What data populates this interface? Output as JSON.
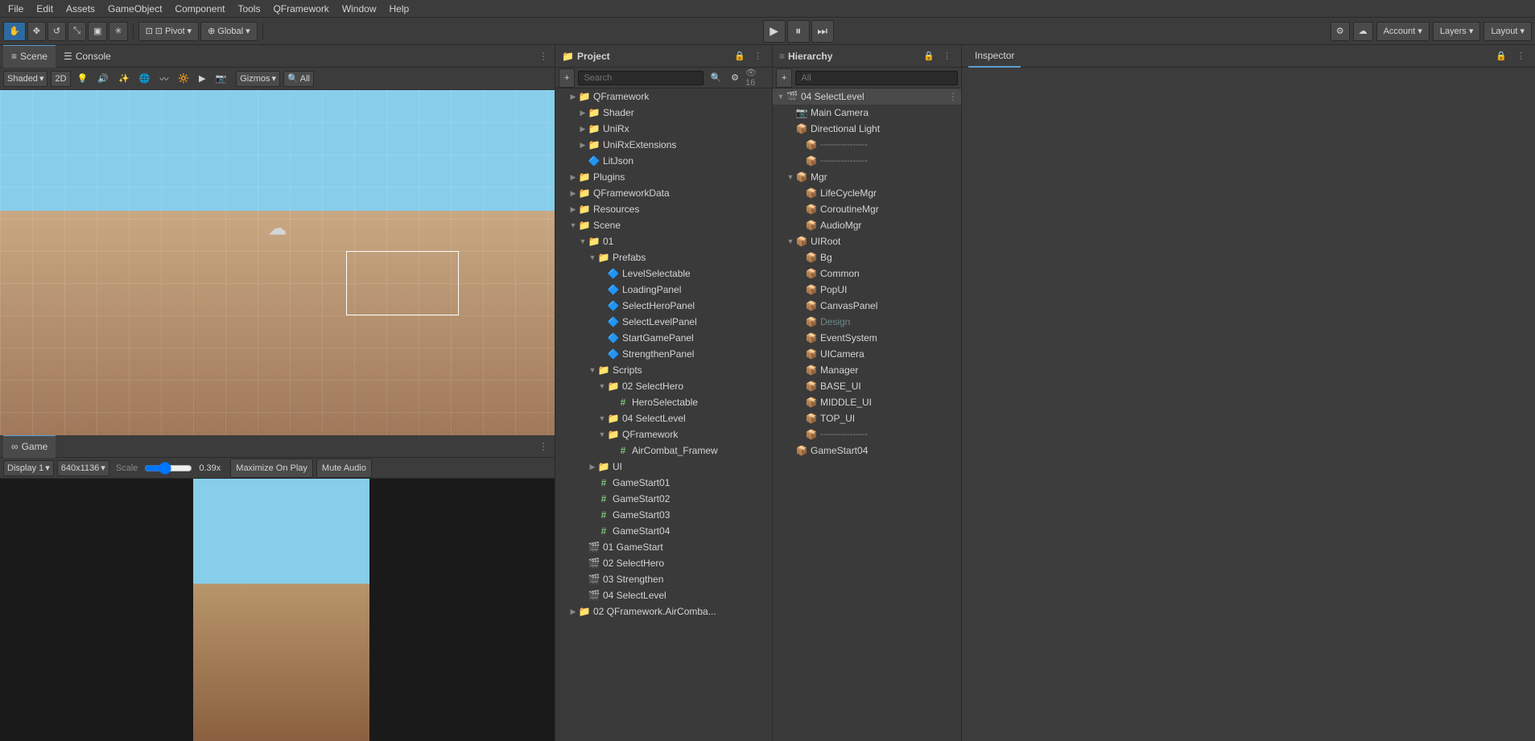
{
  "menubar": {
    "items": [
      "File",
      "Edit",
      "Assets",
      "GameObject",
      "Component",
      "Tools",
      "QFramework",
      "Window",
      "Help"
    ]
  },
  "toolbar": {
    "tools": [
      {
        "name": "hand",
        "icon": "✋",
        "label": "Hand Tool"
      },
      {
        "name": "move",
        "icon": "✥",
        "label": "Move Tool"
      },
      {
        "name": "rotate",
        "icon": "↺",
        "label": "Rotate Tool"
      },
      {
        "name": "scale",
        "icon": "⤡",
        "label": "Scale Tool"
      },
      {
        "name": "rect",
        "icon": "▣",
        "label": "Rect Tool"
      },
      {
        "name": "transform",
        "icon": "✳",
        "label": "Transform Tool"
      }
    ],
    "pivot_label": "⊡ Pivot",
    "global_label": "⊕ Global",
    "play_label": "▶",
    "pause_label": "⏸",
    "step_label": "⏭",
    "account_label": "Account",
    "layers_label": "Layers",
    "layout_label": "Layout",
    "cloud_icon": "☁",
    "settings_icon": "⚙"
  },
  "scene_panel": {
    "tabs": [
      {
        "name": "scene",
        "icon": "≡",
        "label": "Scene"
      },
      {
        "name": "console",
        "icon": "☰",
        "label": "Console"
      }
    ],
    "toolbar": {
      "shaded_label": "Shaded",
      "2d_label": "2D",
      "gizmos_label": "Gizmos",
      "all_label": "All"
    }
  },
  "game_panel": {
    "tab_label": "Game",
    "tab_icon": "∞",
    "display_label": "Display 1",
    "resolution_label": "640x1136",
    "scale_label": "Scale",
    "scale_value": "0.39x",
    "maximize_label": "Maximize On Play",
    "mute_label": "Mute Audio",
    "menu_icon": "⋮"
  },
  "project_panel": {
    "title": "Project",
    "lock_icon": "🔒",
    "menu_icon": "⋮",
    "add_icon": "+",
    "search_placeholder": "Search",
    "count_label": "16",
    "tree": [
      {
        "id": "qframework",
        "indent": 1,
        "arrow": "▶",
        "icon": "📁",
        "label": "QFramework",
        "type": "folder"
      },
      {
        "id": "shader",
        "indent": 2,
        "arrow": "▶",
        "icon": "📁",
        "label": "Shader",
        "type": "folder"
      },
      {
        "id": "unirx",
        "indent": 2,
        "arrow": "▶",
        "icon": "📁",
        "label": "UniRx",
        "type": "folder"
      },
      {
        "id": "unirxextensions",
        "indent": 2,
        "arrow": "▶",
        "icon": "📁",
        "label": "UniRxExtensions",
        "type": "folder"
      },
      {
        "id": "litjson",
        "indent": 2,
        "arrow": " ",
        "icon": "📄",
        "label": "LitJson",
        "type": "file"
      },
      {
        "id": "plugins",
        "indent": 1,
        "arrow": "▶",
        "icon": "📁",
        "label": "Plugins",
        "type": "folder"
      },
      {
        "id": "qframeworkdata",
        "indent": 1,
        "arrow": "▶",
        "icon": "📁",
        "label": "QFrameworkData",
        "type": "folder"
      },
      {
        "id": "resources",
        "indent": 1,
        "arrow": "▶",
        "icon": "📁",
        "label": "Resources",
        "type": "folder"
      },
      {
        "id": "scene",
        "indent": 1,
        "arrow": "▼",
        "icon": "📁",
        "label": "Scene",
        "type": "folder"
      },
      {
        "id": "01",
        "indent": 2,
        "arrow": "▼",
        "icon": "📁",
        "label": "01",
        "type": "folder"
      },
      {
        "id": "prefabs",
        "indent": 3,
        "arrow": "▼",
        "icon": "📁",
        "label": "Prefabs",
        "type": "folder"
      },
      {
        "id": "levelselectable",
        "indent": 4,
        "arrow": " ",
        "icon": "🔷",
        "label": "LevelSelectable",
        "type": "prefab"
      },
      {
        "id": "loadingpanel",
        "indent": 4,
        "arrow": " ",
        "icon": "🔷",
        "label": "LoadingPanel",
        "type": "prefab"
      },
      {
        "id": "selectheropanel",
        "indent": 4,
        "arrow": " ",
        "icon": "🔷",
        "label": "SelectHeroPanel",
        "type": "prefab"
      },
      {
        "id": "selectlevelpanel",
        "indent": 4,
        "arrow": " ",
        "icon": "🔷",
        "label": "SelectLevelPanel",
        "type": "prefab"
      },
      {
        "id": "startgamepanel",
        "indent": 4,
        "arrow": " ",
        "icon": "🔷",
        "label": "StartGamePanel",
        "type": "prefab"
      },
      {
        "id": "strengthenpanel",
        "indent": 4,
        "arrow": " ",
        "icon": "🔷",
        "label": "StrengthenPanel",
        "type": "prefab"
      },
      {
        "id": "scripts",
        "indent": 3,
        "arrow": "▼",
        "icon": "📁",
        "label": "Scripts",
        "type": "folder"
      },
      {
        "id": "02selecthero",
        "indent": 4,
        "arrow": "▼",
        "icon": "📁",
        "label": "02 SelectHero",
        "type": "folder"
      },
      {
        "id": "heroselectable",
        "indent": 5,
        "arrow": " ",
        "icon": "#",
        "label": "HeroSelectable",
        "type": "script"
      },
      {
        "id": "04selectlevel",
        "indent": 4,
        "arrow": "▼",
        "icon": "📁",
        "label": "04 SelectLevel",
        "type": "folder"
      },
      {
        "id": "qframework2",
        "indent": 4,
        "arrow": "▼",
        "icon": "📁",
        "label": "QFramework",
        "type": "folder"
      },
      {
        "id": "aircombatframew",
        "indent": 5,
        "arrow": " ",
        "icon": "#",
        "label": "AirCombat_Framew",
        "type": "script"
      },
      {
        "id": "ui",
        "indent": 3,
        "arrow": "▶",
        "icon": "📁",
        "label": "UI",
        "type": "folder"
      },
      {
        "id": "gamestart01",
        "indent": 3,
        "arrow": " ",
        "icon": "#",
        "label": "GameStart01",
        "type": "script"
      },
      {
        "id": "gamestart02",
        "indent": 3,
        "arrow": " ",
        "icon": "#",
        "label": "GameStart02",
        "type": "script"
      },
      {
        "id": "gamestart03",
        "indent": 3,
        "arrow": " ",
        "icon": "#",
        "label": "GameStart03",
        "type": "script"
      },
      {
        "id": "gamestart04",
        "indent": 3,
        "arrow": " ",
        "icon": "#",
        "label": "GameStart04",
        "type": "script"
      },
      {
        "id": "scene01gamestart",
        "indent": 2,
        "arrow": " ",
        "icon": "🎬",
        "label": "01 GameStart",
        "type": "scene"
      },
      {
        "id": "scene02selecthero",
        "indent": 2,
        "arrow": " ",
        "icon": "🎬",
        "label": "02 SelectHero",
        "type": "scene"
      },
      {
        "id": "scene03strengthen",
        "indent": 2,
        "arrow": " ",
        "icon": "🎬",
        "label": "03 Strengthen",
        "type": "scene"
      },
      {
        "id": "scene04selectlevel",
        "indent": 2,
        "arrow": " ",
        "icon": "🎬",
        "label": "04 SelectLevel",
        "type": "scene"
      },
      {
        "id": "02qframeworkaircomba",
        "indent": 1,
        "arrow": "▶",
        "icon": "📁",
        "label": "02 QFramework.AirComba...",
        "type": "folder"
      }
    ]
  },
  "hierarchy_panel": {
    "title": "Hierarchy",
    "lock_icon": "🔒",
    "menu_icon": "⋮",
    "add_icon": "+",
    "search_placeholder": "All",
    "selected_scene": "04 SelectLevel",
    "tree": [
      {
        "id": "04selectlevel",
        "indent": 0,
        "arrow": "▼",
        "icon": "🎬",
        "label": "04 SelectLevel",
        "type": "scene",
        "selected": false,
        "menu": true
      },
      {
        "id": "maincamera",
        "indent": 1,
        "arrow": " ",
        "icon": "📷",
        "label": "Main Camera",
        "type": "camera"
      },
      {
        "id": "directionallight",
        "indent": 1,
        "arrow": " ",
        "icon": "💡",
        "label": "Directional Light",
        "type": "light"
      },
      {
        "id": "sep1",
        "indent": 1,
        "arrow": " ",
        "icon": "—",
        "label": "----------------",
        "type": "separator"
      },
      {
        "id": "sep2",
        "indent": 1,
        "arrow": " ",
        "icon": "—",
        "label": "----------------",
        "type": "separator"
      },
      {
        "id": "mgr",
        "indent": 1,
        "arrow": "▼",
        "icon": "📦",
        "label": "Mgr",
        "type": "gameobject"
      },
      {
        "id": "lifecyclemgr",
        "indent": 2,
        "arrow": " ",
        "icon": "📦",
        "label": "LifeCycleMgr",
        "type": "gameobject"
      },
      {
        "id": "coroutinemgr",
        "indent": 2,
        "arrow": " ",
        "icon": "📦",
        "label": "CoroutineMgr",
        "type": "gameobject"
      },
      {
        "id": "audiomgr",
        "indent": 2,
        "arrow": " ",
        "icon": "📦",
        "label": "AudioMgr",
        "type": "gameobject"
      },
      {
        "id": "uiroot",
        "indent": 1,
        "arrow": "▼",
        "icon": "📦",
        "label": "UIRoot",
        "type": "gameobject"
      },
      {
        "id": "bg",
        "indent": 2,
        "arrow": " ",
        "icon": "📦",
        "label": "Bg",
        "type": "gameobject"
      },
      {
        "id": "common",
        "indent": 2,
        "arrow": " ",
        "icon": "📦",
        "label": "Common",
        "type": "gameobject"
      },
      {
        "id": "popui",
        "indent": 2,
        "arrow": " ",
        "icon": "📦",
        "label": "PopUI",
        "type": "gameobject"
      },
      {
        "id": "canvaspanel",
        "indent": 2,
        "arrow": " ",
        "icon": "📦",
        "label": "CanvasPanel",
        "type": "gameobject"
      },
      {
        "id": "design",
        "indent": 2,
        "arrow": " ",
        "icon": "📦",
        "label": "Design",
        "type": "gameobject",
        "inactive": true
      },
      {
        "id": "eventsystem",
        "indent": 2,
        "arrow": " ",
        "icon": "📦",
        "label": "EventSystem",
        "type": "gameobject"
      },
      {
        "id": "uicamera",
        "indent": 2,
        "arrow": " ",
        "icon": "📦",
        "label": "UICamera",
        "type": "gameobject"
      },
      {
        "id": "manager",
        "indent": 2,
        "arrow": " ",
        "icon": "📦",
        "label": "Manager",
        "type": "gameobject"
      },
      {
        "id": "baseui",
        "indent": 2,
        "arrow": " ",
        "icon": "📦",
        "label": "BASE_UI",
        "type": "gameobject"
      },
      {
        "id": "middleui",
        "indent": 2,
        "arrow": " ",
        "icon": "📦",
        "label": "MIDDLE_UI",
        "type": "gameobject"
      },
      {
        "id": "topui",
        "indent": 2,
        "arrow": " ",
        "icon": "📦",
        "label": "TOP_UI",
        "type": "gameobject"
      },
      {
        "id": "sep3",
        "indent": 1,
        "arrow": " ",
        "icon": "—",
        "label": "----------------",
        "type": "separator"
      },
      {
        "id": "gamestart04",
        "indent": 1,
        "arrow": " ",
        "icon": "📦",
        "label": "GameStart04",
        "type": "gameobject"
      }
    ]
  },
  "inspector_panel": {
    "title": "Inspector",
    "lock_icon": "🔒",
    "menu_icon": "⋮"
  }
}
